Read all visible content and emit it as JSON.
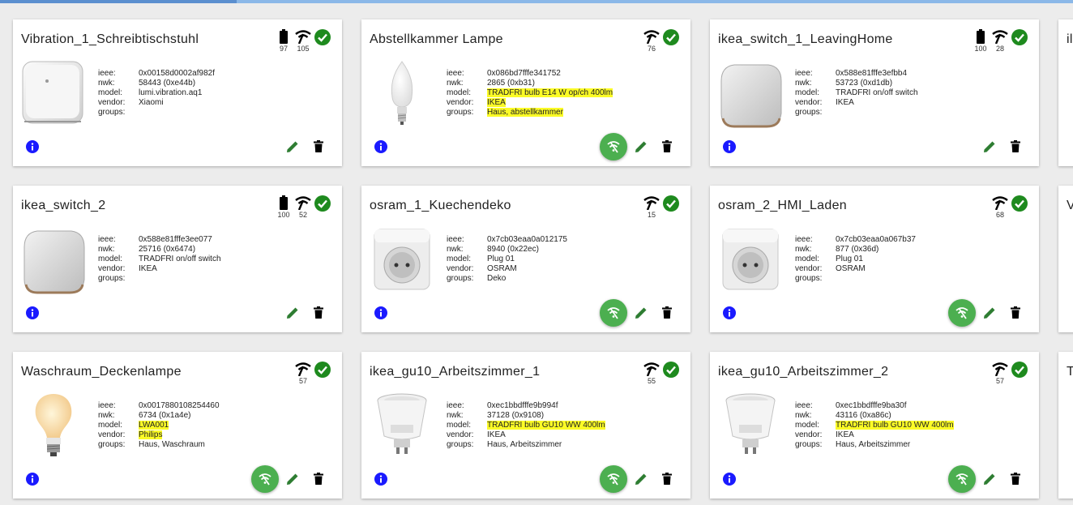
{
  "labels": {
    "ieee": "ieee:",
    "nwk": "nwk:",
    "model": "model:",
    "vendor": "vendor:",
    "groups": "groups:"
  },
  "colors": {
    "ok": "#1e8a1e",
    "edit": "#2e7d32",
    "info": "#1a1aff",
    "map_button": "#4caf50",
    "highlight": "#fbfb26"
  },
  "cards": [
    {
      "title": "Vibration_1_Schreibtischstuhl",
      "battery": "97",
      "link": "105",
      "ieee": "0x00158d0002af982f",
      "nwk": "58443 (0xe44b)",
      "model": "lumi.vibration.aq1",
      "vendor": "Xiaomi",
      "groups": ""
    },
    {
      "title": "Abstellkammer Lampe",
      "link": "76",
      "ieee": "0x086bd7fffe341752",
      "nwk": "2865 (0xb31)",
      "model": "TRADFRI bulb E14 W op/ch 400lm",
      "vendor": "IKEA",
      "groups": "Haus, abstellkammer"
    },
    {
      "title": "ikea_switch_1_LeavingHome",
      "battery": "100",
      "link": "28",
      "ieee": "0x588e81fffe3efbb4",
      "nwk": "53723 (0xd1db)",
      "model": "TRADFRI on/off switch",
      "vendor": "IKEA",
      "groups": ""
    },
    {
      "title": "ikea_switch_2",
      "battery": "100",
      "link": "52",
      "ieee": "0x588e81fffe3ee077",
      "nwk": "25716 (0x6474)",
      "model": "TRADFRI on/off switch",
      "vendor": "IKEA",
      "groups": ""
    },
    {
      "title": "osram_1_Kuechendeko",
      "link": "15",
      "ieee": "0x7cb03eaa0a012175",
      "nwk": "8940 (0x22ec)",
      "model": "Plug 01",
      "vendor": "OSRAM",
      "groups": "Deko"
    },
    {
      "title": "osram_2_HMI_Laden",
      "link": "68",
      "ieee": "0x7cb03eaa0a067b37",
      "nwk": "877 (0x36d)",
      "model": "Plug 01",
      "vendor": "OSRAM",
      "groups": ""
    },
    {
      "title": "Waschraum_Deckenlampe",
      "link": "57",
      "ieee": "0x0017880108254460",
      "nwk": "6734 (0x1a4e)",
      "model": "LWA001",
      "vendor": "Philips",
      "groups": "Haus, Waschraum"
    },
    {
      "title": "ikea_gu10_Arbeitszimmer_1",
      "link": "55",
      "ieee": "0xec1bbdfffe9b994f",
      "nwk": "37128 (0x9108)",
      "model": "TRADFRI bulb GU10 WW 400lm",
      "vendor": "IKEA",
      "groups": "Haus, Arbeitszimmer"
    },
    {
      "title": "ikea_gu10_Arbeitszimmer_2",
      "link": "57",
      "ieee": "0xec1bbdfffe9ba30f",
      "nwk": "43116 (0xa86c)",
      "model": "TRADFRI bulb GU10 WW 400lm",
      "vendor": "IKEA",
      "groups": "Haus, Arbeitszimmer"
    }
  ],
  "partial_cards": [
    {
      "title": "il"
    },
    {
      "title": "V"
    },
    {
      "title": "T"
    }
  ]
}
